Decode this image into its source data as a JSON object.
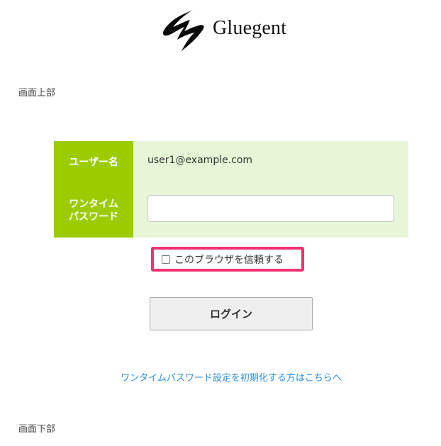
{
  "logo": {
    "text": "Gluegent",
    "icon": "gluegent-logo-icon"
  },
  "page_top_label": "画面上部",
  "page_bottom_label": "画面下部",
  "form": {
    "username_label": "ユーザー名",
    "username_value": "user1@example.com",
    "otp_label_line1": "ワンタイム",
    "otp_label_line2": "パスワード",
    "otp_value": "",
    "otp_placeholder": ""
  },
  "trust_browser": {
    "label": "このブラウザを信頼する",
    "checked": false
  },
  "login_button_label": "ログイン",
  "reset_link_text": "ワンタイムパスワード設定を初期化する方はこちらへ",
  "colors": {
    "label_bg": "#9ccc00",
    "form_bg": "#e6f6d7",
    "highlight_border": "#f0326e",
    "link": "#2e8fe0"
  }
}
